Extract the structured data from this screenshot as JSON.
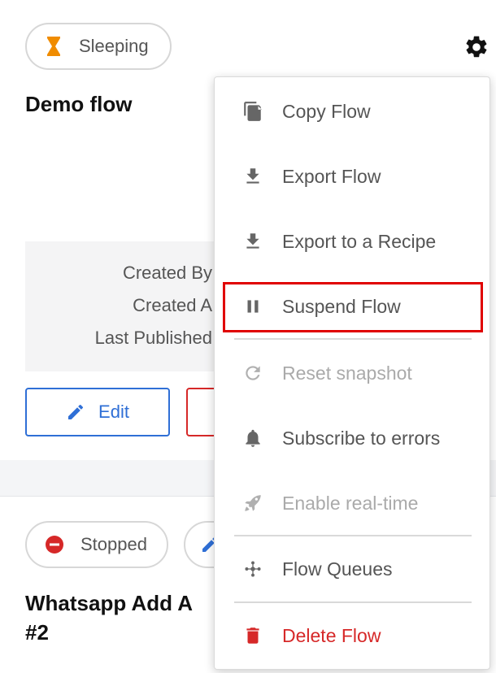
{
  "card1": {
    "status_label": "Sleeping",
    "title": "Demo flow",
    "info": {
      "created_by": "Created By",
      "created_at": "Created A",
      "last_published": "Last Published"
    },
    "edit_label": "Edit"
  },
  "card2": {
    "status_label": "Stopped",
    "title": "Whatsapp Add A #2"
  },
  "menu": {
    "items": [
      {
        "label": "Copy Flow",
        "icon": "copy-icon"
      },
      {
        "label": "Export Flow",
        "icon": "download-icon"
      },
      {
        "label": "Export to a Recipe",
        "icon": "download-icon"
      },
      {
        "label": "Suspend Flow",
        "icon": "pause-icon",
        "highlighted": true
      },
      {
        "label": "Reset snapshot",
        "icon": "refresh-icon",
        "disabled": true
      },
      {
        "label": "Subscribe to errors",
        "icon": "bell-icon"
      },
      {
        "label": "Enable real-time",
        "icon": "rocket-icon",
        "disabled": true
      },
      {
        "label": "Flow Queues",
        "icon": "queues-icon"
      },
      {
        "label": "Delete Flow",
        "icon": "trash-icon",
        "danger": true
      }
    ]
  },
  "colors": {
    "primary": "#2f6fd6",
    "danger": "#d62828",
    "sleeping_icon": "#f08c00",
    "highlight_box": "#e00000"
  }
}
